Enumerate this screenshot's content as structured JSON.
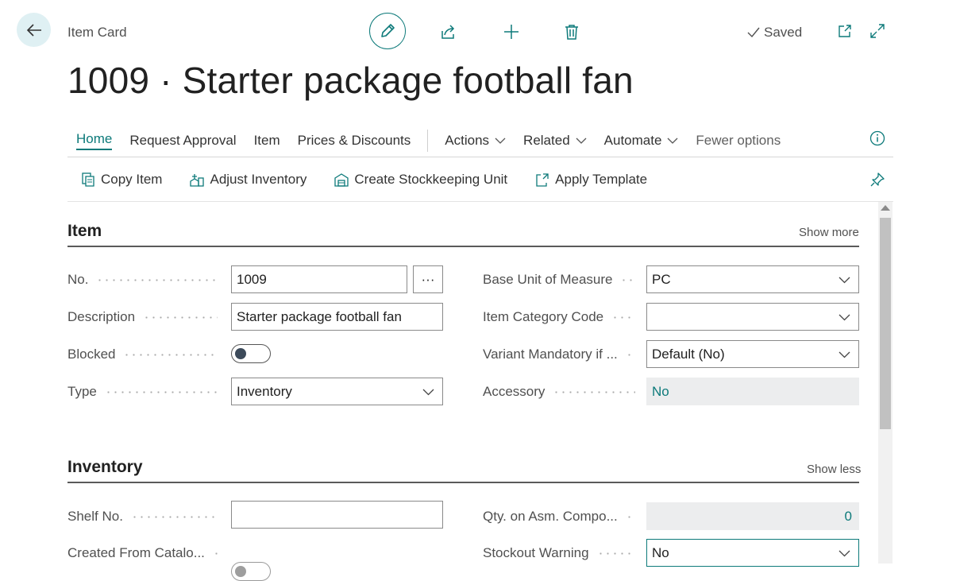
{
  "header": {
    "breadcrumb": "Item Card",
    "saved_label": "Saved",
    "title": "1009 · Starter package football fan"
  },
  "tabs": [
    {
      "label": "Home"
    },
    {
      "label": "Request Approval"
    },
    {
      "label": "Item"
    },
    {
      "label": "Prices & Discounts"
    },
    {
      "label": "Actions"
    },
    {
      "label": "Related"
    },
    {
      "label": "Automate"
    },
    {
      "label": "Fewer options"
    }
  ],
  "actions": [
    {
      "label": "Copy Item",
      "icon": "copy-icon"
    },
    {
      "label": "Adjust Inventory",
      "icon": "adjust-inventory-icon"
    },
    {
      "label": "Create Stockkeeping Unit",
      "icon": "stockkeeping-icon"
    },
    {
      "label": "Apply Template",
      "icon": "apply-template-icon"
    }
  ],
  "sections": {
    "item": {
      "title": "Item",
      "link": "Show more",
      "fields": {
        "no": {
          "label": "No.",
          "value": "1009",
          "assist": "···"
        },
        "description": {
          "label": "Description",
          "value": "Starter package football fan"
        },
        "blocked": {
          "label": "Blocked",
          "value": false
        },
        "type": {
          "label": "Type",
          "value": "Inventory"
        },
        "base_uom": {
          "label": "Base Unit of Measure",
          "value": "PC"
        },
        "item_category": {
          "label": "Item Category Code",
          "value": ""
        },
        "variant_mandatory": {
          "label": "Variant Mandatory if ...",
          "value": "Default (No)"
        },
        "accessory": {
          "label": "Accessory",
          "value": "No"
        }
      }
    },
    "inventory": {
      "title": "Inventory",
      "link": "Show less",
      "fields": {
        "shelf_no": {
          "label": "Shelf No.",
          "value": ""
        },
        "created_from_catalog": {
          "label": "Created From Catalo...",
          "value": false
        },
        "qty_asm": {
          "label": "Qty. on Asm. Compo...",
          "value": "0"
        },
        "stockout_warning": {
          "label": "Stockout Warning",
          "value": "No"
        }
      }
    }
  },
  "colors": {
    "accent": "#0d7a7a",
    "back_button_bg": "#dff0f3",
    "readonly_bg": "#ecedee"
  }
}
